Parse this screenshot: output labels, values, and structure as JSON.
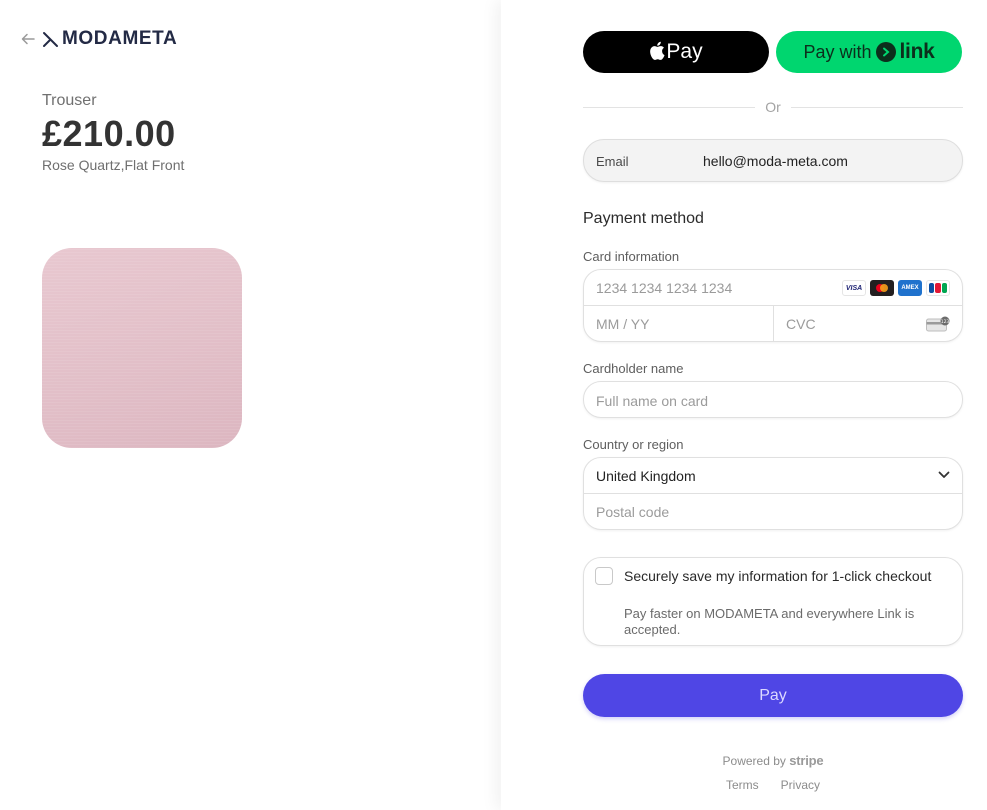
{
  "merchant": {
    "name": "MODAMETA",
    "back_icon": "arrow-left-icon"
  },
  "product": {
    "name": "Trouser",
    "price": "£210.00",
    "variant": "Rose Quartz,Flat Front",
    "image_color": "#e4c3cb"
  },
  "express": {
    "applepay_label": "Pay",
    "link_prefix": "Pay with",
    "link_word": "link"
  },
  "divider": {
    "label": "Or"
  },
  "contact": {
    "email_label": "Email",
    "email_value": "hello@moda-meta.com"
  },
  "payment": {
    "title": "Payment method",
    "card_label": "Card information",
    "card_number_placeholder": "1234 1234 1234 1234",
    "expiry_placeholder": "MM / YY",
    "cvc_placeholder": "CVC",
    "card_brands": [
      "VISA",
      "Mastercard",
      "Amex",
      "JCB"
    ],
    "cardholder_label": "Cardholder name",
    "cardholder_placeholder": "Full name on card",
    "region_label": "Country or region",
    "region_value": "United Kingdom",
    "postal_placeholder": "Postal code"
  },
  "save": {
    "title": "Securely save my information for 1-click checkout",
    "description": "Pay faster on MODAMETA and everywhere Link is accepted."
  },
  "pay_button": {
    "label": "Pay"
  },
  "footer": {
    "powered_by": "Powered by",
    "brand": "stripe",
    "terms": "Terms",
    "privacy": "Privacy"
  },
  "colors": {
    "accent": "#4f46e5",
    "link_green": "#00d66f",
    "logo_navy": "#232a45"
  }
}
